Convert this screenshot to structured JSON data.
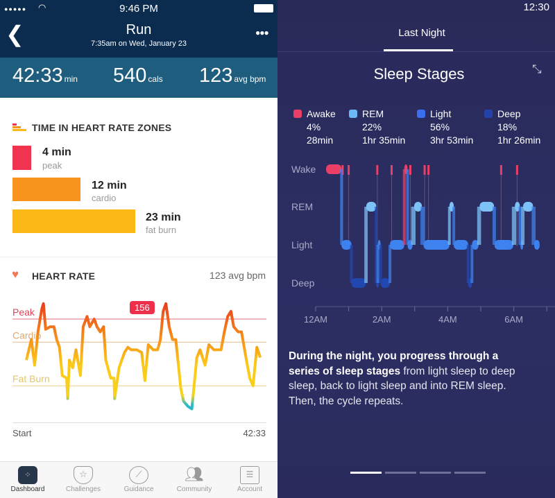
{
  "left": {
    "status": {
      "time": "9:46 PM"
    },
    "header": {
      "title": "Run",
      "subtitle": "7:35am on Wed, January 23"
    },
    "stats": [
      {
        "value": "42:33",
        "unit": "min"
      },
      {
        "value": "540",
        "unit": "cals"
      },
      {
        "value": "123",
        "unit": "avg bpm"
      }
    ],
    "zones": {
      "title": "TIME IN HEART RATE ZONES",
      "items": [
        {
          "value": "4 min",
          "label": "peak",
          "minutes": 4,
          "color": "#f0344f"
        },
        {
          "value": "12 min",
          "label": "cardio",
          "minutes": 12,
          "color": "#f7941d"
        },
        {
          "value": "23 min",
          "label": "fat burn",
          "minutes": 23,
          "color": "#fbb817"
        }
      ]
    },
    "heart_rate": {
      "title": "HEART RATE",
      "avg": "123 avg bpm",
      "peak_marker": "156",
      "start_label": "Start",
      "end_label": "42:33"
    },
    "tabs": [
      {
        "label": "Dashboard"
      },
      {
        "label": "Challenges"
      },
      {
        "label": "Guidance"
      },
      {
        "label": "Community"
      },
      {
        "label": "Account"
      }
    ]
  },
  "chart_data": [
    {
      "type": "line",
      "xlabel": "",
      "ylabel": "",
      "x_labels": [
        "Start",
        "42:33"
      ],
      "zones": [
        {
          "name": "Peak",
          "bpm": 150,
          "color": "#d9455b"
        },
        {
          "name": "Cardio",
          "bpm": 141,
          "color": "#e0a96a"
        },
        {
          "name": "Fat Burn",
          "bpm": 124,
          "color": "#e6c66a"
        }
      ],
      "max_label": "156",
      "x_minutes": [
        0,
        0.9,
        1.5,
        2.1,
        2.8,
        3.1,
        3.5,
        4.3,
        5,
        5.5,
        6,
        6.5,
        7.3,
        7.5,
        7.8,
        8.4,
        9,
        9.8,
        10.3,
        11,
        11.5,
        12.3,
        12.8,
        13.4,
        14,
        14.4,
        15.3,
        15.9,
        16,
        16.8,
        17.8,
        18.4,
        19,
        20,
        20.9,
        21.5,
        22.1,
        23,
        23.8,
        24.3,
        24.8,
        25.3,
        25.9,
        26.5,
        27.1,
        28,
        28.5,
        29.3,
        30,
        30.9,
        31.5,
        32.4,
        33.1,
        34,
        35.3,
        35.9,
        36.5,
        37.1,
        37.6,
        38.4,
        39,
        39.9,
        40.5,
        41.1,
        41.8,
        42.4
      ],
      "bpm": [
        134,
        142,
        132,
        145,
        154,
        156,
        146,
        147,
        147,
        142,
        139,
        128,
        127,
        119,
        134,
        131,
        138,
        128,
        147,
        151,
        147,
        150,
        147,
        145,
        147,
        134,
        127,
        127,
        119,
        131,
        137,
        139,
        138,
        138,
        137,
        126,
        140,
        138,
        138,
        142,
        153,
        156,
        147,
        142,
        142,
        123,
        118,
        116,
        115,
        135,
        138,
        132,
        140,
        138,
        138,
        145,
        151,
        153,
        147,
        145,
        145,
        134,
        127,
        124,
        139,
        135
      ]
    },
    {
      "type": "step",
      "title": "Sleep Stages",
      "stages": [
        "Wake",
        "REM",
        "Light",
        "Deep"
      ],
      "x_ticks": [
        "12AM",
        "2AM",
        "4AM",
        "6AM"
      ],
      "legend": [
        {
          "name": "Awake",
          "percent": "4%",
          "duration": "28min",
          "color": "#ea4068"
        },
        {
          "name": "REM",
          "percent": "22%",
          "duration": "1hr 35min",
          "color": "#6cb8f5"
        },
        {
          "name": "Light",
          "percent": "56%",
          "duration": "3hr 53min",
          "color": "#3a6ff0"
        },
        {
          "name": "Deep",
          "percent": "18%",
          "duration": "1hr 26min",
          "color": "#2443a8"
        }
      ],
      "segments": [
        [
          "Wake",
          "00:19",
          "00:47"
        ],
        [
          "Light",
          "00:47",
          "01:05"
        ],
        [
          "Deep",
          "01:05",
          "01:31"
        ],
        [
          "REM",
          "01:32",
          "01:50"
        ],
        [
          "Deep",
          "01:50",
          "01:53"
        ],
        [
          "Light",
          "01:53",
          "01:58"
        ],
        [
          "Deep",
          "01:58",
          "02:15"
        ],
        [
          "Light",
          "02:15",
          "02:41"
        ],
        [
          "Wake",
          "02:41",
          "02:47"
        ],
        [
          "Light",
          "02:47",
          "02:56"
        ],
        [
          "REM",
          "02:59",
          "03:13"
        ],
        [
          "Light",
          "03:16",
          "04:03"
        ],
        [
          "REM",
          "04:03",
          "04:11"
        ],
        [
          "Light",
          "04:11",
          "04:37"
        ],
        [
          "Deep",
          "04:37",
          "04:44"
        ],
        [
          "Light",
          "04:44",
          "04:56"
        ],
        [
          "REM",
          "04:58",
          "05:24"
        ],
        [
          "Light",
          "05:25",
          "05:59"
        ],
        [
          "REM",
          "06:02",
          "06:11"
        ],
        [
          "Light",
          "06:12",
          "06:16"
        ],
        [
          "REM",
          "06:17",
          "06:35"
        ],
        [
          "Light",
          "06:37",
          "06:47"
        ]
      ],
      "brief_wakes": [
        "00:49",
        "01:00",
        "01:52",
        "02:18",
        "02:52",
        "03:18",
        "03:25",
        "05:37",
        "06:06"
      ]
    }
  ],
  "right": {
    "status": {
      "time": "12:30"
    },
    "tab": "Last Night",
    "description_bold1": "During the night, you progress through a series of sleep stages",
    "description_rest": " from light sleep to deep sleep, back to light sleep and into REM sleep. Then, the cycle repeats.",
    "pages": {
      "count": 4,
      "current": 1
    }
  }
}
